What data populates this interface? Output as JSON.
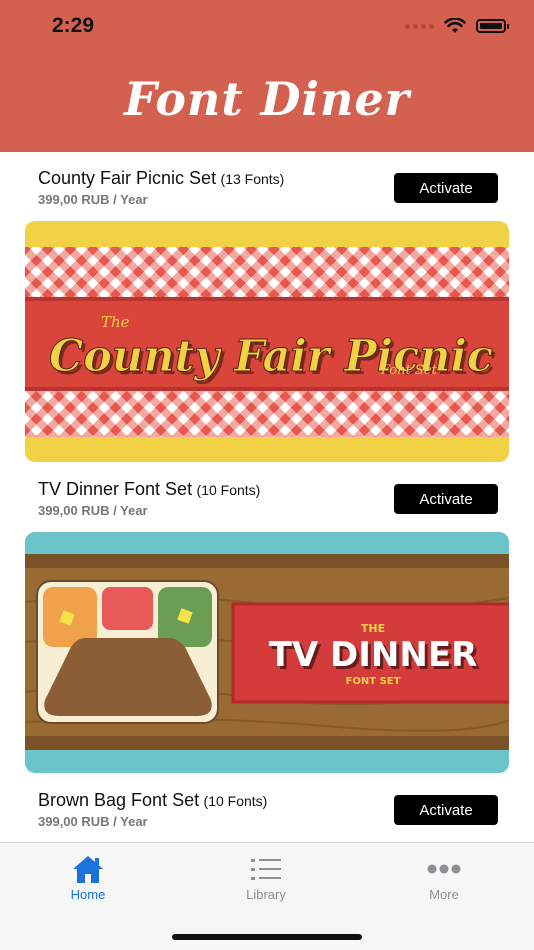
{
  "status": {
    "time": "2:29"
  },
  "header": {
    "title": "Font Diner"
  },
  "items": [
    {
      "name": "County Fair Picnic Set",
      "count": "(13 Fonts)",
      "price": "399,00 RUB / Year",
      "button": "Activate",
      "banner": {
        "small": "The",
        "main": "County Fair Picnic",
        "sub": "Font Set"
      }
    },
    {
      "name": "TV Dinner Font Set",
      "count": "(10 Fonts)",
      "price": "399,00 RUB / Year",
      "button": "Activate",
      "banner": {
        "small": "THE",
        "main": "TV DINNER",
        "sub": "FONT SET"
      }
    },
    {
      "name": "Brown Bag Font Set",
      "count": "(10 Fonts)",
      "price": "399,00 RUB / Year",
      "button": "Activate"
    }
  ],
  "tabs": [
    {
      "label": "Home",
      "icon": "house-icon",
      "active": true
    },
    {
      "label": "Library",
      "icon": "list-icon",
      "active": false
    },
    {
      "label": "More",
      "icon": "ellipsis-icon",
      "active": false
    }
  ],
  "colors": {
    "header": "#d46150",
    "accent": "#1a73d9",
    "button": "#000000"
  }
}
